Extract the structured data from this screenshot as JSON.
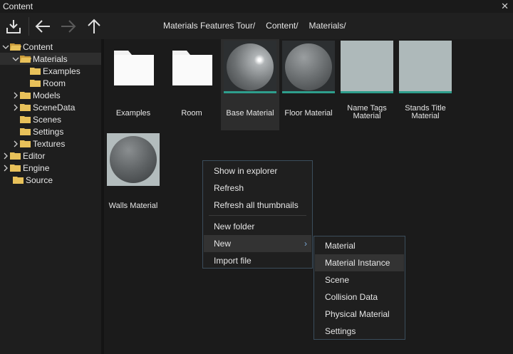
{
  "window": {
    "title": "Content",
    "close_glyph": "✕"
  },
  "toolbar": {
    "icons": [
      "import-icon",
      "back-arrow-icon",
      "forward-arrow-icon",
      "up-arrow-icon"
    ]
  },
  "breadcrumb": [
    "Materials Features Tour/",
    "Content/",
    "Materials/"
  ],
  "tree": {
    "items": [
      {
        "label": "Content",
        "expanded": true
      },
      {
        "label": "Materials",
        "expanded": true,
        "selected": true
      },
      {
        "label": "Examples"
      },
      {
        "label": "Room"
      },
      {
        "label": "Models"
      },
      {
        "label": "SceneData"
      },
      {
        "label": "Scenes"
      },
      {
        "label": "Settings"
      },
      {
        "label": "Textures"
      },
      {
        "label": "Editor"
      },
      {
        "label": "Engine"
      },
      {
        "label": "Source"
      }
    ]
  },
  "content": {
    "items": [
      {
        "label": "Examples",
        "kind": "folder"
      },
      {
        "label": "Room",
        "kind": "folder"
      },
      {
        "label": "Base Material",
        "kind": "material",
        "selected": true
      },
      {
        "label": "Floor Material",
        "kind": "material"
      },
      {
        "label": "Name Tags Material",
        "kind": "flat-material"
      },
      {
        "label": "Stands Title Material",
        "kind": "flat-material"
      },
      {
        "label": "Walls Material",
        "kind": "sphere"
      }
    ]
  },
  "context_menu": {
    "items": [
      "Show in explorer",
      "Refresh",
      "Refresh all thumbnails",
      "New folder",
      "New",
      "Import file"
    ],
    "submenu_arrow": "›"
  },
  "submenu": {
    "items": [
      "Material",
      "Material Instance",
      "Scene",
      "Collision Data",
      "Physical Material",
      "Settings"
    ]
  },
  "colors": {
    "accent_bar": "#2e9e8c",
    "menu_border": "#3b4d5c",
    "folder": "#e8c15a"
  }
}
